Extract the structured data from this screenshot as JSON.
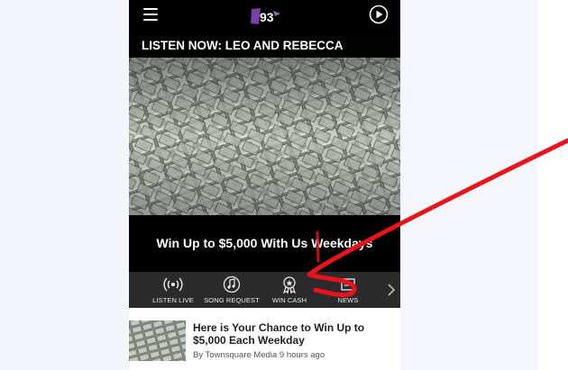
{
  "header": {
    "menu_icon": "hamburger-menu-icon",
    "logo_text": "B93",
    "play_icon": "play-circle-icon"
  },
  "hero": {
    "title": "LISTEN NOW: LEO AND REBECCA",
    "caption": "Win Up to $5,000 With Us Weekdays"
  },
  "tabs": [
    {
      "label": "LISTEN LIVE",
      "icon": "broadcast-icon"
    },
    {
      "label": "SONG REQUEST",
      "icon": "music-note-icon"
    },
    {
      "label": "WIN CASH",
      "icon": "award-ribbon-icon"
    },
    {
      "label": "NEWS",
      "icon": "news-icon"
    }
  ],
  "article": {
    "title": "Here is Your Chance to Win Up to $5,000 Each Weekday",
    "meta": "By Townsquare Media 9 hours ago"
  },
  "colors": {
    "annotation_red": "#e8131b",
    "topbar": "#000000",
    "tabbar": "#2b2b2b",
    "logo_purple": "#7b3fa8"
  }
}
